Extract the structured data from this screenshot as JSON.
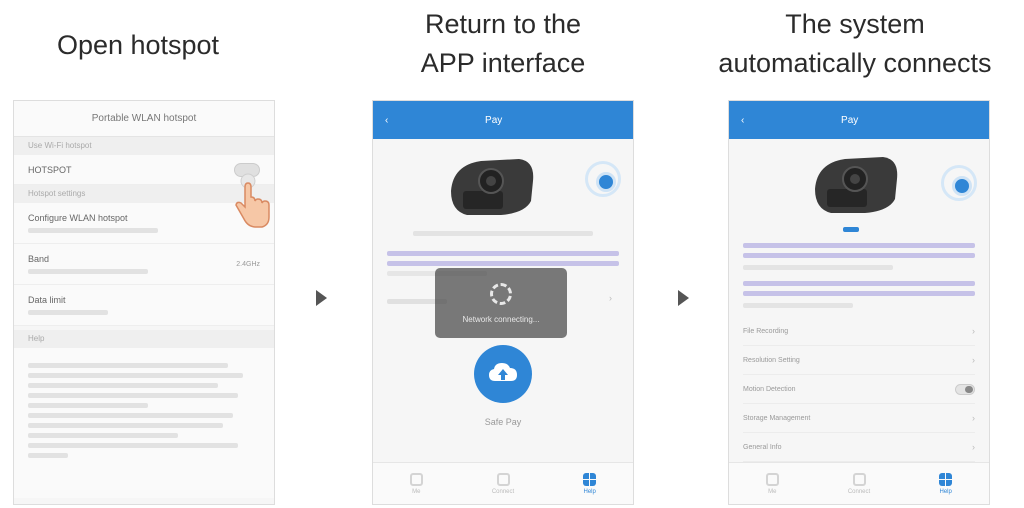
{
  "captions": {
    "step1": "Open hotspot",
    "step2_line1": "Return to the",
    "step2_line2": "APP interface",
    "step3_line1": "The system",
    "step3_line2": "automatically connects"
  },
  "panel1": {
    "title": "Portable WLAN hotspot",
    "section_top": "Use Wi-Fi hotspot",
    "hotspot_name": "HOTSPOT",
    "section_settings": "Hotspot settings",
    "configure_title": "Configure WLAN hotspot",
    "band_label": "Band",
    "band_value": "2.4GHz",
    "data_limit_title": "Data limit",
    "help_header": "Help"
  },
  "panel2": {
    "back_icon": "back-icon",
    "title": "Pay",
    "overlay_message": "Network connecting...",
    "upload_label": "Safe Pay",
    "tabs": [
      "Me",
      "Connect",
      "Help"
    ]
  },
  "panel3": {
    "back_icon": "back-icon",
    "title": "Pay",
    "menu_items": [
      "File Recording",
      "Resolution Setting",
      "Motion Detection",
      "Storage Management",
      "General Info"
    ],
    "tabs": [
      "Me",
      "Connect",
      "Help"
    ]
  },
  "colors": {
    "accent": "#2f86d6",
    "caption": "#2b2b2b"
  }
}
